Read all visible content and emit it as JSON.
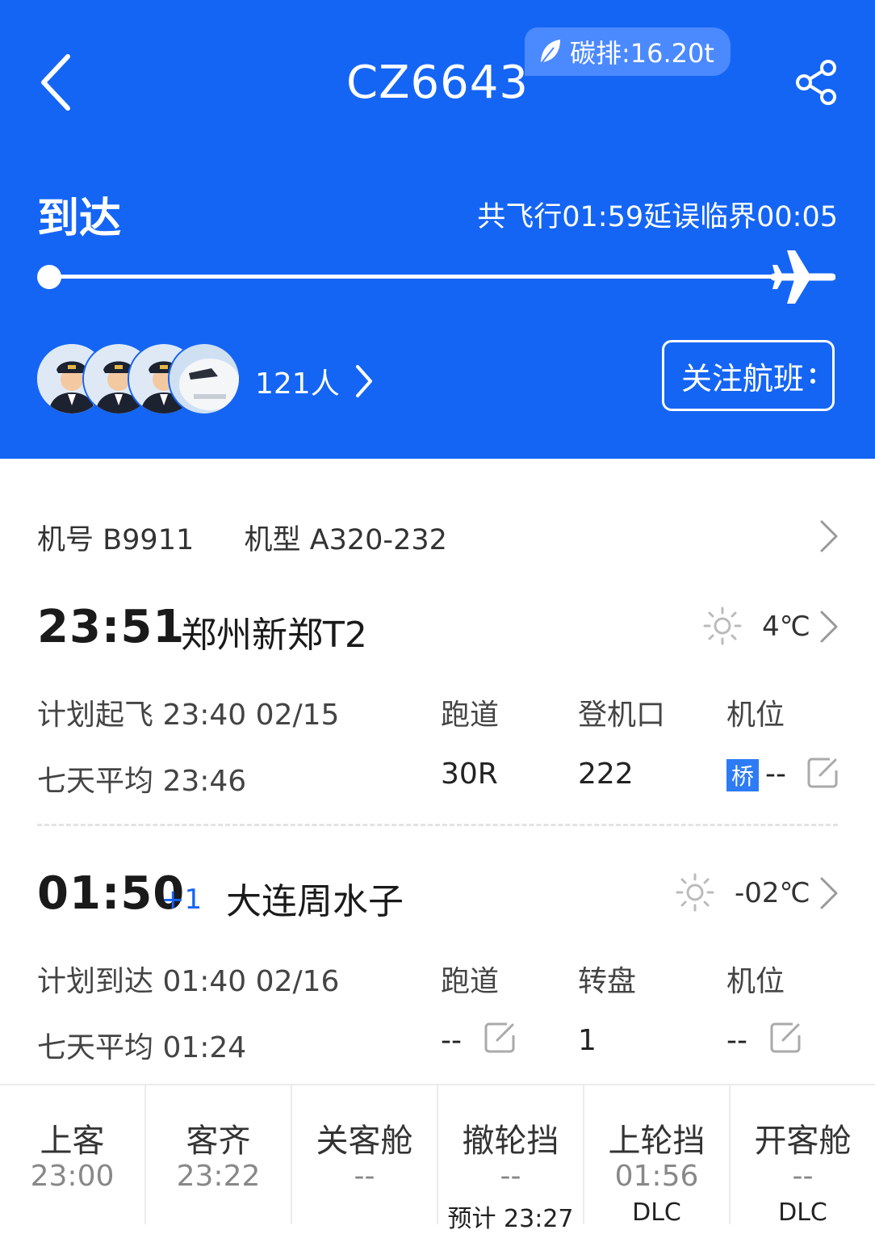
{
  "header": {
    "flight_number": "CZ6643",
    "carbon_label": "碳排:16.20t",
    "status": "到达",
    "timing_text": "共飞行01:59延误临界00:05",
    "passengers_label": "121人",
    "follow_label": "关注航班",
    "progress": 1.0,
    "colors": {
      "brand": "#1565f5"
    }
  },
  "aircraft": {
    "reg_label": "机号",
    "reg_value": "B9911",
    "type_label": "机型",
    "type_value": "A320-232"
  },
  "departure": {
    "time": "23:51",
    "airport": "郑州新郑T2",
    "temp": "4℃",
    "weather_icon": "sun-icon",
    "planned_label": "计划起飞",
    "planned_value": "23:40 02/15",
    "avg_label": "七天平均",
    "avg_value": "23:46",
    "col1_label": "跑道",
    "col1_value": "30R",
    "col2_label": "登机口",
    "col2_value": "222",
    "col3_label": "机位",
    "bridge_badge": "桥",
    "col3_value": "--"
  },
  "arrival": {
    "time": "01:50",
    "day_offset": "+1",
    "airport": "大连周水子",
    "temp": "-02℃",
    "weather_icon": "sun-icon",
    "planned_label": "计划到达",
    "planned_value": "01:40 02/16",
    "avg_label": "七天平均",
    "avg_value": "01:24",
    "col1_label": "跑道",
    "col1_value": "--",
    "col2_label": "转盘",
    "col2_value": "1",
    "col3_label": "机位",
    "col3_value": "--"
  },
  "milestones": [
    {
      "title": "上客",
      "value": "23:00",
      "sub": ""
    },
    {
      "title": "客齐",
      "value": "23:22",
      "sub": ""
    },
    {
      "title": "关客舱",
      "value": "--",
      "sub": ""
    },
    {
      "title": "撤轮挡",
      "value": "--",
      "sub": "预计 23:27"
    },
    {
      "title": "上轮挡",
      "value": "01:56",
      "sub": "DLC"
    },
    {
      "title": "开客舱",
      "value": "--",
      "sub": "DLC"
    }
  ]
}
